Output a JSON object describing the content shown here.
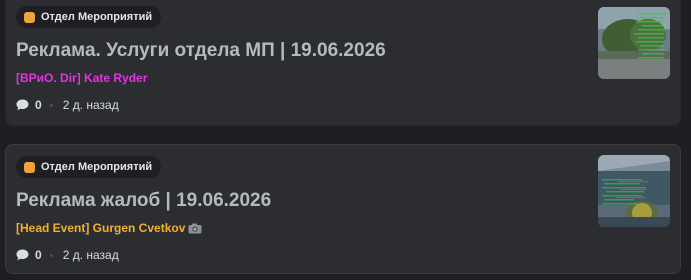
{
  "posts": [
    {
      "tag": {
        "label": "Отдел Мероприятий",
        "icon": "orange-square-icon",
        "color": "#f0a33a"
      },
      "title": "Реклама. Услуги отдела МП | 19.06.2026",
      "author": {
        "text": "[ВРиО. Dir] Kate Ryder",
        "color": "#e532e5"
      },
      "comments": "0",
      "time": "2 д. назад",
      "thumbnail": "photo-thumbnail"
    },
    {
      "tag": {
        "label": "Отдел Мероприятий",
        "icon": "orange-square-icon",
        "color": "#f0a33a"
      },
      "title": "Реклама жалоб | 19.06.2026",
      "author": {
        "text": "[Head Event] Gurgen Cvetkov",
        "color": "#f1b12b",
        "suffix_icon": "camera-icon"
      },
      "comments": "0",
      "time": "2 д. назад",
      "thumbnail": "photo-thumbnail"
    }
  ],
  "colors": {
    "background": "#1e1f22",
    "card": "#2b2d31",
    "title": "#b5bac1"
  }
}
